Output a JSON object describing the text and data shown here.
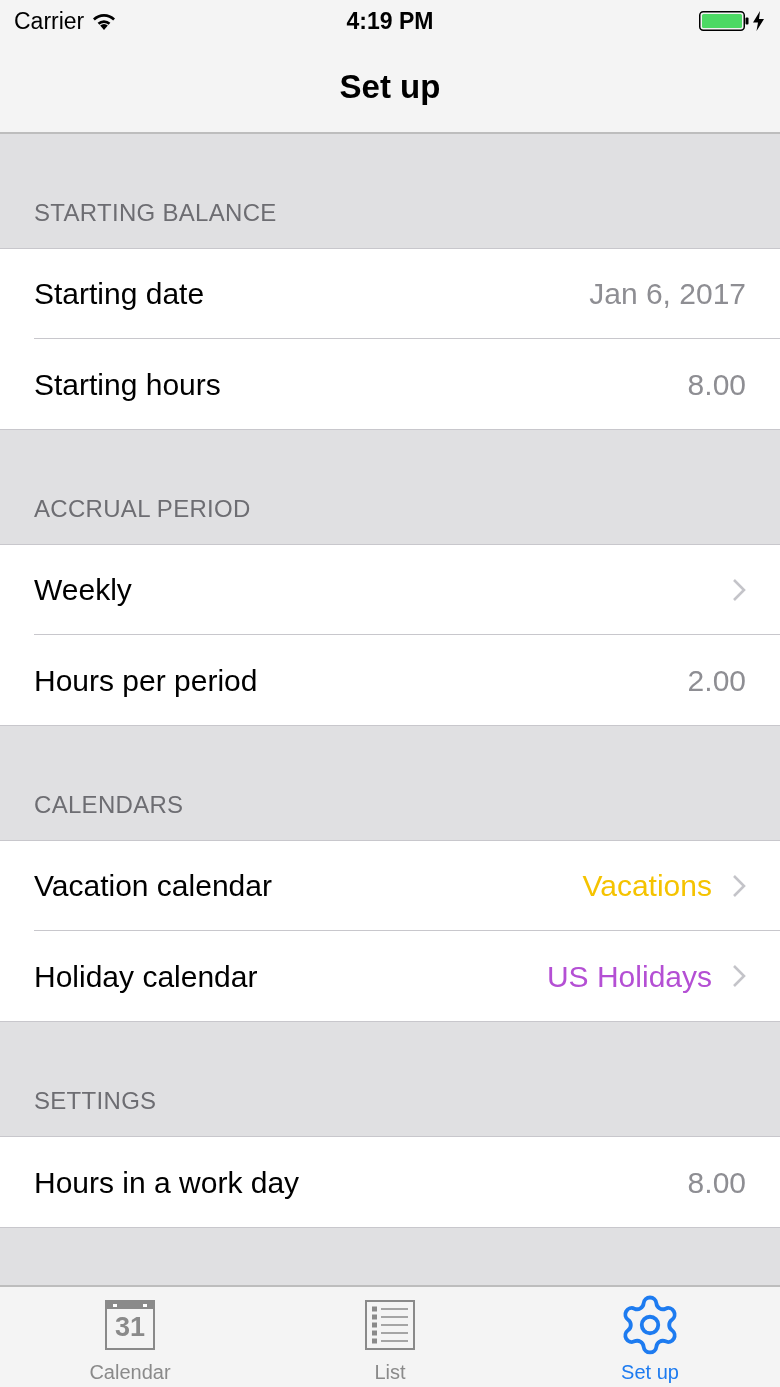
{
  "status_bar": {
    "carrier": "Carrier",
    "time": "4:19 PM",
    "charging": true
  },
  "nav_bar": {
    "title": "Set up"
  },
  "sections": [
    {
      "header": "STARTING BALANCE",
      "rows": [
        {
          "label": "Starting date",
          "value": "Jan 6, 2017",
          "disclosure": false
        },
        {
          "label": "Starting hours",
          "value": "8.00",
          "disclosure": false
        }
      ]
    },
    {
      "header": "ACCRUAL PERIOD",
      "rows": [
        {
          "label": "Weekly",
          "disclosure": true
        },
        {
          "label": "Hours per period",
          "value": "2.00",
          "disclosure": false
        }
      ]
    },
    {
      "header": "CALENDARS",
      "rows": [
        {
          "label": "Vacation calendar",
          "value": "Vacations",
          "color": "#f5c300",
          "disclosure": true
        },
        {
          "label": "Holiday calendar",
          "value": "US Holidays",
          "color": "#b44fd4",
          "disclosure": true
        }
      ]
    },
    {
      "header": "SETTINGS",
      "rows": [
        {
          "label": "Hours in a work day",
          "value": "8.00",
          "disclosure": false
        }
      ]
    }
  ],
  "tab_bar": {
    "tabs": [
      {
        "kind": "calendar",
        "label": "Calendar",
        "icon_text": "31",
        "selected": false
      },
      {
        "kind": "list",
        "label": "List",
        "selected": false
      },
      {
        "kind": "gear",
        "label": "Set up",
        "selected": true
      }
    ]
  }
}
